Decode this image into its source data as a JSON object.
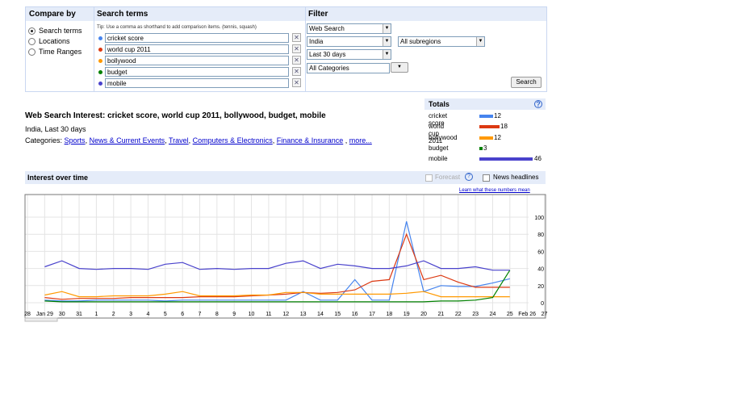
{
  "compare_by": {
    "header": "Compare by",
    "options": [
      {
        "label": "Search terms",
        "selected": true
      },
      {
        "label": "Locations",
        "selected": false
      },
      {
        "label": "Time Ranges",
        "selected": false
      }
    ]
  },
  "search_terms": {
    "header": "Search terms",
    "tip": "Tip: Use a comma as shorthand to add comparison items. (tennis, squash)",
    "terms": [
      {
        "value": "cricket score",
        "color": "#4684ee"
      },
      {
        "value": "world cup 2011",
        "color": "#dc3912"
      },
      {
        "value": "bollywood",
        "color": "#ff9900"
      },
      {
        "value": "budget",
        "color": "#008000"
      },
      {
        "value": "mobile",
        "color": "#4942cc"
      }
    ],
    "remove_glyph": "✕"
  },
  "filter": {
    "header": "Filter",
    "property": "Web Search",
    "location": "India",
    "subregion": "All subregions",
    "time": "Last 30 days",
    "category": "All Categories",
    "search_button": "Search",
    "arrow": "▼"
  },
  "summary": {
    "title": "Web Search Interest: cricket score, world cup 2011, bollywood, budget, mobile",
    "subtitle": "India, Last 30 days",
    "categories_label": "Categories:",
    "categories": [
      "Sports",
      "News & Current Events",
      "Travel",
      "Computers & Electronics",
      "Finance & Insurance"
    ],
    "more": "more..."
  },
  "totals": {
    "header": "Totals",
    "help": "?",
    "rows": [
      {
        "label": "cricket score",
        "value": 12,
        "color": "#4684ee"
      },
      {
        "label": "world cup 2011",
        "value": 18,
        "color": "#dc3912"
      },
      {
        "label": "bollywood",
        "value": 12,
        "color": "#ff9900"
      },
      {
        "label": "budget",
        "value": 3,
        "color": "#008000"
      },
      {
        "label": "mobile",
        "value": 46,
        "color": "#4942cc"
      }
    ]
  },
  "interest_over_time": {
    "header": "Interest over time",
    "forecast": "Forecast",
    "forecast_help": "?",
    "news_headlines": "News headlines",
    "learn": "Learn what these numbers mean"
  },
  "chart_data": {
    "type": "line",
    "x": [
      "28",
      "Jan 29",
      "30",
      "31",
      "1",
      "2",
      "3",
      "4",
      "5",
      "6",
      "7",
      "8",
      "9",
      "10",
      "11",
      "12",
      "13",
      "14",
      "15",
      "16",
      "17",
      "18",
      "19",
      "20",
      "21",
      "22",
      "23",
      "24",
      "25",
      "Feb 26",
      "27"
    ],
    "ylim": [
      0,
      100
    ],
    "yticks": [
      0,
      20,
      40,
      60,
      80,
      100
    ],
    "grid": true,
    "series": [
      {
        "name": "cricket score",
        "color": "#4684ee",
        "values": [
          null,
          3,
          2,
          2,
          3,
          3,
          3,
          3,
          2,
          3,
          3,
          3,
          3,
          3,
          3,
          3,
          13,
          3,
          3,
          27,
          3,
          3,
          95,
          13,
          20,
          19,
          19,
          23,
          28,
          null,
          null
        ]
      },
      {
        "name": "world cup 2011",
        "color": "#dc3912",
        "values": [
          null,
          6,
          4,
          5,
          5,
          5,
          6,
          6,
          6,
          6,
          7,
          7,
          7,
          8,
          9,
          10,
          12,
          11,
          12,
          15,
          25,
          27,
          80,
          27,
          32,
          24,
          18,
          18,
          18,
          null,
          null
        ]
      },
      {
        "name": "bollywood",
        "color": "#ff9900",
        "values": [
          null,
          9,
          13,
          7,
          7,
          8,
          8,
          8,
          10,
          13,
          8,
          8,
          8,
          9,
          9,
          12,
          12,
          10,
          10,
          10,
          10,
          10,
          11,
          13,
          7,
          7,
          7,
          7,
          7,
          null,
          null
        ]
      },
      {
        "name": "budget",
        "color": "#008000",
        "values": [
          null,
          2,
          1,
          1,
          1,
          1,
          1,
          1,
          1,
          1,
          1,
          1,
          1,
          1,
          1,
          1,
          1,
          1,
          1,
          1,
          1,
          1,
          1,
          1,
          2,
          2,
          3,
          6,
          38,
          null,
          null
        ]
      },
      {
        "name": "mobile",
        "color": "#4942cc",
        "values": [
          null,
          42,
          49,
          40,
          39,
          40,
          40,
          39,
          45,
          47,
          39,
          40,
          39,
          40,
          40,
          46,
          49,
          40,
          45,
          43,
          40,
          40,
          43,
          49,
          40,
          40,
          42,
          38,
          38,
          null,
          null
        ]
      }
    ]
  }
}
